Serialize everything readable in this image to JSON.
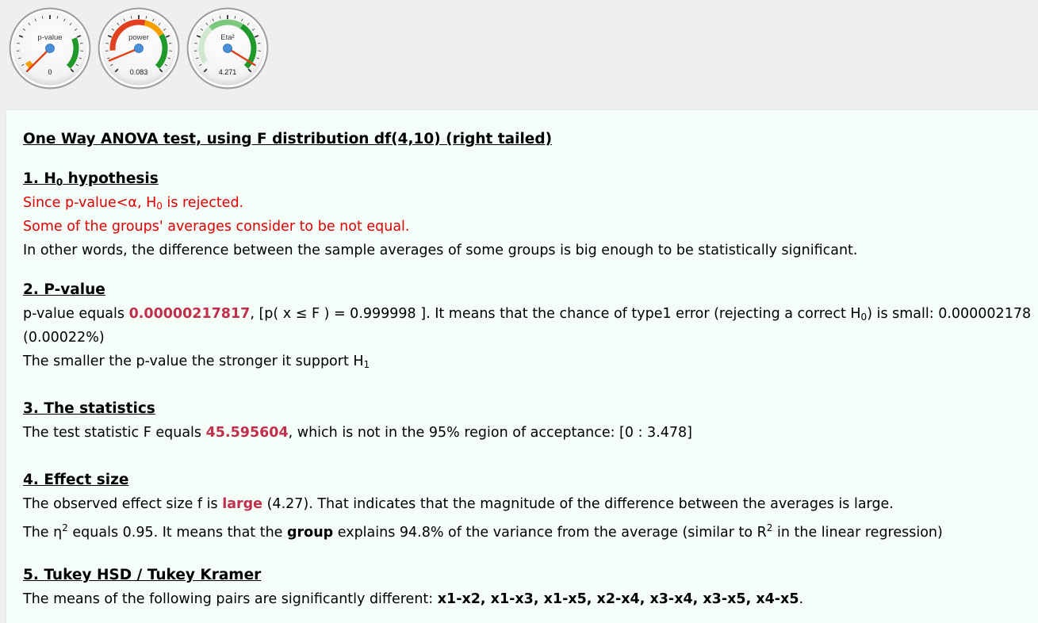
{
  "gauges": [
    {
      "label": "p-value",
      "value": "0",
      "needle_fraction": 0.0
    },
    {
      "label": "power",
      "value": "0.083",
      "needle_fraction": 0.083
    },
    {
      "label": "Eta²",
      "value": "4.271",
      "needle_fraction": 0.95
    }
  ],
  "colors": {
    "accent_value": "#c0304c",
    "rejected_text": "#e00000",
    "result_background": "#f4fdf8",
    "gauge_green": "#1f9a2a",
    "gauge_orange": "#f5a000",
    "gauge_red": "#e04020",
    "needle": "#e0401a",
    "needle_hub": "#4a90d9"
  },
  "title": "One Way ANOVA test, using F distribution df(4,10) (right tailed)",
  "h0": {
    "heading_prefix": "1. H",
    "heading_sub": "0",
    "heading_suffix": " hypothesis",
    "line1_prefix": "Since p-value<α, H",
    "line1_sub": "0",
    "line1_suffix": " is rejected.",
    "line2": "Some of the groups' averages consider to be not equal.",
    "line3": "In other words, the difference between the sample averages of some groups is big enough to be statistically significant."
  },
  "pvalue": {
    "heading": "2. P-value",
    "prefix": "p-value equals ",
    "value": "0.00000217817",
    "mid": ", [p( x ≤ F ) = 0.999998 ]. It means that the chance of type1 error (rejecting a correct H",
    "mid_sub": "0",
    "suffix": ") is small: 0.000002178",
    "line2": "(0.00022%)",
    "line3_prefix": "The smaller the p-value the stronger it support H",
    "line3_sub": "1"
  },
  "statistics": {
    "heading": "3. The statistics",
    "prefix": "The test statistic F equals ",
    "value": "45.595604",
    "suffix": ", which is not in the 95% region of acceptance: [0 : 3.478]"
  },
  "effect": {
    "heading": "4. Effect size",
    "line1_prefix": "The observed effect size f is ",
    "line1_value": "large",
    "line1_suffix": " (4.27). That indicates that the magnitude of the difference between the averages is large.",
    "line2_a": "The η",
    "line2_sup": "2",
    "line2_b": " equals 0.95. It means that the ",
    "line2_bold": "group",
    "line2_c": " explains 94.8% of the variance from the average (similar to R",
    "line2_sup2": "2",
    "line2_d": " in the linear regression)"
  },
  "tukey": {
    "heading": "5. Tukey HSD / Tukey Kramer",
    "prefix": "The means of the following pairs are significantly different: ",
    "pairs": "x1-x2, x1-x3, x1-x5, x2-x4, x3-x4, x3-x5, x4-x5",
    "suffix": "."
  }
}
